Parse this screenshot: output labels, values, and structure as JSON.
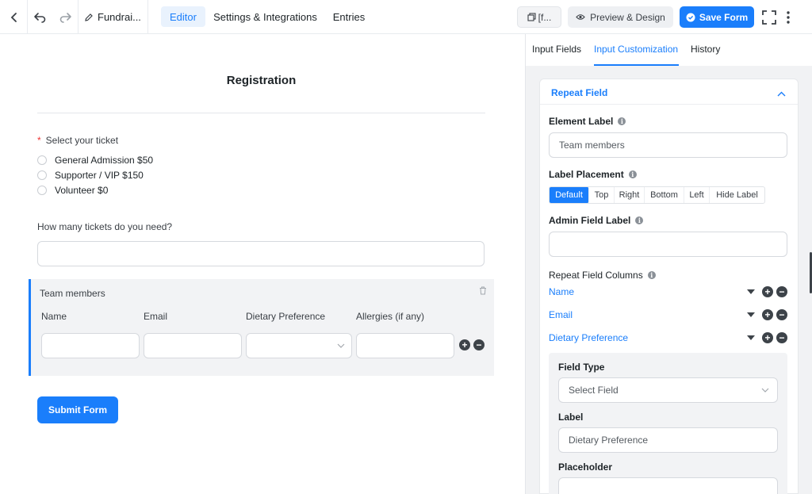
{
  "topbar": {
    "form_title": "Fundrai...",
    "tabs": [
      {
        "label": "Editor",
        "active": true
      },
      {
        "label": "Settings & Integrations",
        "active": false
      },
      {
        "label": "Entries",
        "active": false
      }
    ],
    "shortcode_label": "[f...",
    "preview_label": "Preview & Design",
    "save_label": "Save Form"
  },
  "form": {
    "heading": "Registration",
    "ticket_question": "Select your ticket",
    "required_mark": "*",
    "ticket_options": [
      "General Admission $50",
      "Supporter / VIP $150",
      "Volunteer $0"
    ],
    "tickets_count_question": "How many tickets do you need?",
    "repeat_label": "Team members",
    "repeat_columns": [
      "Name",
      "Email",
      "Dietary Preference",
      "Allergies (if any)"
    ],
    "submit_label": "Submit Form"
  },
  "panel": {
    "tabs": [
      {
        "label": "Input Fields",
        "active": false
      },
      {
        "label": "Input Customization",
        "active": true
      },
      {
        "label": "History",
        "active": false
      }
    ],
    "section_title": "Repeat Field",
    "element_label": {
      "label": "Element Label",
      "value": "Team members"
    },
    "label_placement": {
      "label": "Label Placement",
      "options": [
        "Default",
        "Top",
        "Right",
        "Bottom",
        "Left",
        "Hide Label"
      ],
      "selected": "Default"
    },
    "admin_field_label": {
      "label": "Admin Field Label",
      "value": ""
    },
    "repeat_columns": {
      "label": "Repeat Field Columns",
      "items": [
        "Name",
        "Email",
        "Dietary Preference"
      ]
    },
    "column_settings": {
      "field_type_label": "Field Type",
      "field_type_value": "Select Field",
      "label_label": "Label",
      "label_value": "Dietary Preference",
      "placeholder_label": "Placeholder",
      "placeholder_value": ""
    }
  },
  "colors": {
    "accent": "#1a7efb",
    "dark_button": "#3d4349",
    "panel_bg": "#f1f2f4"
  }
}
